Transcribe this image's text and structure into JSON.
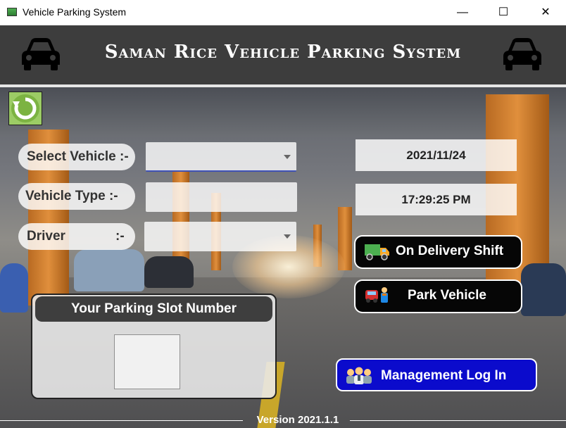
{
  "window": {
    "title": "Vehicle Parking System",
    "controls": {
      "minimize": "—",
      "maximize": "☐",
      "close": "✕"
    }
  },
  "header": {
    "title": "Saman Rice Vehicle Parking System",
    "left_icon": "car-icon",
    "right_icon": "car-icon"
  },
  "toolbar": {
    "refresh_icon": "refresh-icon"
  },
  "form": {
    "select_vehicle_label": "Select Vehicle :-",
    "select_vehicle_value": "",
    "vehicle_type_label": "Vehicle Type :-",
    "vehicle_type_value": "",
    "driver_label": "Driver",
    "driver_colon": ":-",
    "driver_value": ""
  },
  "datetime": {
    "date": "2021/11/24",
    "time": "17:29:25 PM"
  },
  "buttons": {
    "delivery_shift": "On Delivery Shift",
    "park_vehicle": "Park Vehicle",
    "management_login": "Management Log In"
  },
  "slot_panel": {
    "title": "Your Parking Slot Number",
    "value": ""
  },
  "footer": {
    "version": "Version 2021.1.1"
  },
  "colors": {
    "header_bg": "#3d3d3d",
    "refresh_green": "#8bc34a",
    "dark_button": "#060606",
    "login_blue": "#0b0bcc"
  }
}
